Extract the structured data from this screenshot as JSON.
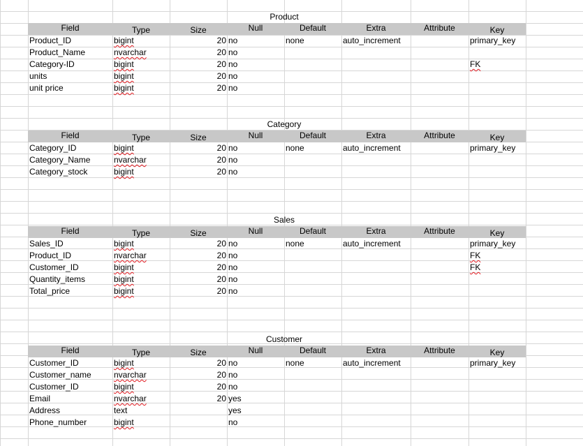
{
  "columns": [
    "Field",
    "Type",
    "Size",
    "Null",
    "Default",
    "Extra",
    "Attribute",
    "Key"
  ],
  "tables": [
    {
      "title": "Product",
      "rows": [
        {
          "field": "Product_ID",
          "type": "bigint",
          "size": "20",
          "null": "no",
          "default": "none",
          "extra": "auto_increment",
          "key": "primary_key"
        },
        {
          "field": "Product_Name",
          "type": "nvarchar",
          "size": "20",
          "null": "no",
          "default": "",
          "extra": "",
          "key": ""
        },
        {
          "field": "Category-ID",
          "type": "bigint",
          "size": "20",
          "null": "no",
          "default": "",
          "extra": "",
          "key": "FK"
        },
        {
          "field": "units",
          "type": "bigint",
          "size": "20",
          "null": "no",
          "default": "",
          "extra": "",
          "key": ""
        },
        {
          "field": "unit price",
          "type": "bigint",
          "size": "20",
          "null": "no",
          "default": "",
          "extra": "",
          "key": ""
        }
      ]
    },
    {
      "title": "Category",
      "rows": [
        {
          "field": "Category_ID",
          "type": "bigint",
          "size": "20",
          "null": "no",
          "default": "none",
          "extra": "auto_increment",
          "key": "primary_key"
        },
        {
          "field": "Category_Name",
          "type": "nvarchar",
          "size": "20",
          "null": "no",
          "default": "",
          "extra": "",
          "key": ""
        },
        {
          "field": "Category_stock",
          "type": "bigint",
          "size": "20",
          "null": "no",
          "default": "",
          "extra": "",
          "key": ""
        }
      ]
    },
    {
      "title": "Sales",
      "rows": [
        {
          "field": "Sales_ID",
          "type": "bigint",
          "size": "20",
          "null": "no",
          "default": "none",
          "extra": "auto_increment",
          "key": "primary_key"
        },
        {
          "field": "Product_ID",
          "type": "nvarchar",
          "size": "20",
          "null": "no",
          "default": "",
          "extra": "",
          "key": "FK"
        },
        {
          "field": "Customer_ID",
          "type": "bigint",
          "size": "20",
          "null": "no",
          "default": "",
          "extra": "",
          "key": "FK"
        },
        {
          "field": "Quantity_items",
          "type": "bigint",
          "size": "20",
          "null": "no",
          "default": "",
          "extra": "",
          "key": ""
        },
        {
          "field": "Total_price",
          "type": "bigint",
          "size": "20",
          "null": "no",
          "default": "",
          "extra": "",
          "key": ""
        }
      ]
    },
    {
      "title": "Customer",
      "rows": [
        {
          "field": "Customer_ID",
          "type": "bigint",
          "size": "20",
          "null": "no",
          "default": "none",
          "extra": "auto_increment",
          "key": "primary_key"
        },
        {
          "field": "Customer_name",
          "type": "nvarchar",
          "size": "20",
          "null": "no",
          "default": "",
          "extra": "",
          "key": ""
        },
        {
          "field": "Customer_ID",
          "type": "bigint",
          "size": "20",
          "null": "no",
          "default": "",
          "extra": "",
          "key": ""
        },
        {
          "field": "Email",
          "type": "nvarchar",
          "size": "20",
          "null": "yes",
          "default": "",
          "extra": "",
          "key": ""
        },
        {
          "field": "Address",
          "type": "text",
          "size": "",
          "null": "yes",
          "default": "",
          "extra": "",
          "key": ""
        },
        {
          "field": "Phone_number",
          "type": "bigint",
          "size": "",
          "null": "no",
          "default": "",
          "extra": "",
          "key": ""
        }
      ]
    }
  ],
  "colors": {
    "gridline": "#d6d6d6",
    "header_fill": "#c8c8c8",
    "spellcheck": "#e0161c"
  }
}
